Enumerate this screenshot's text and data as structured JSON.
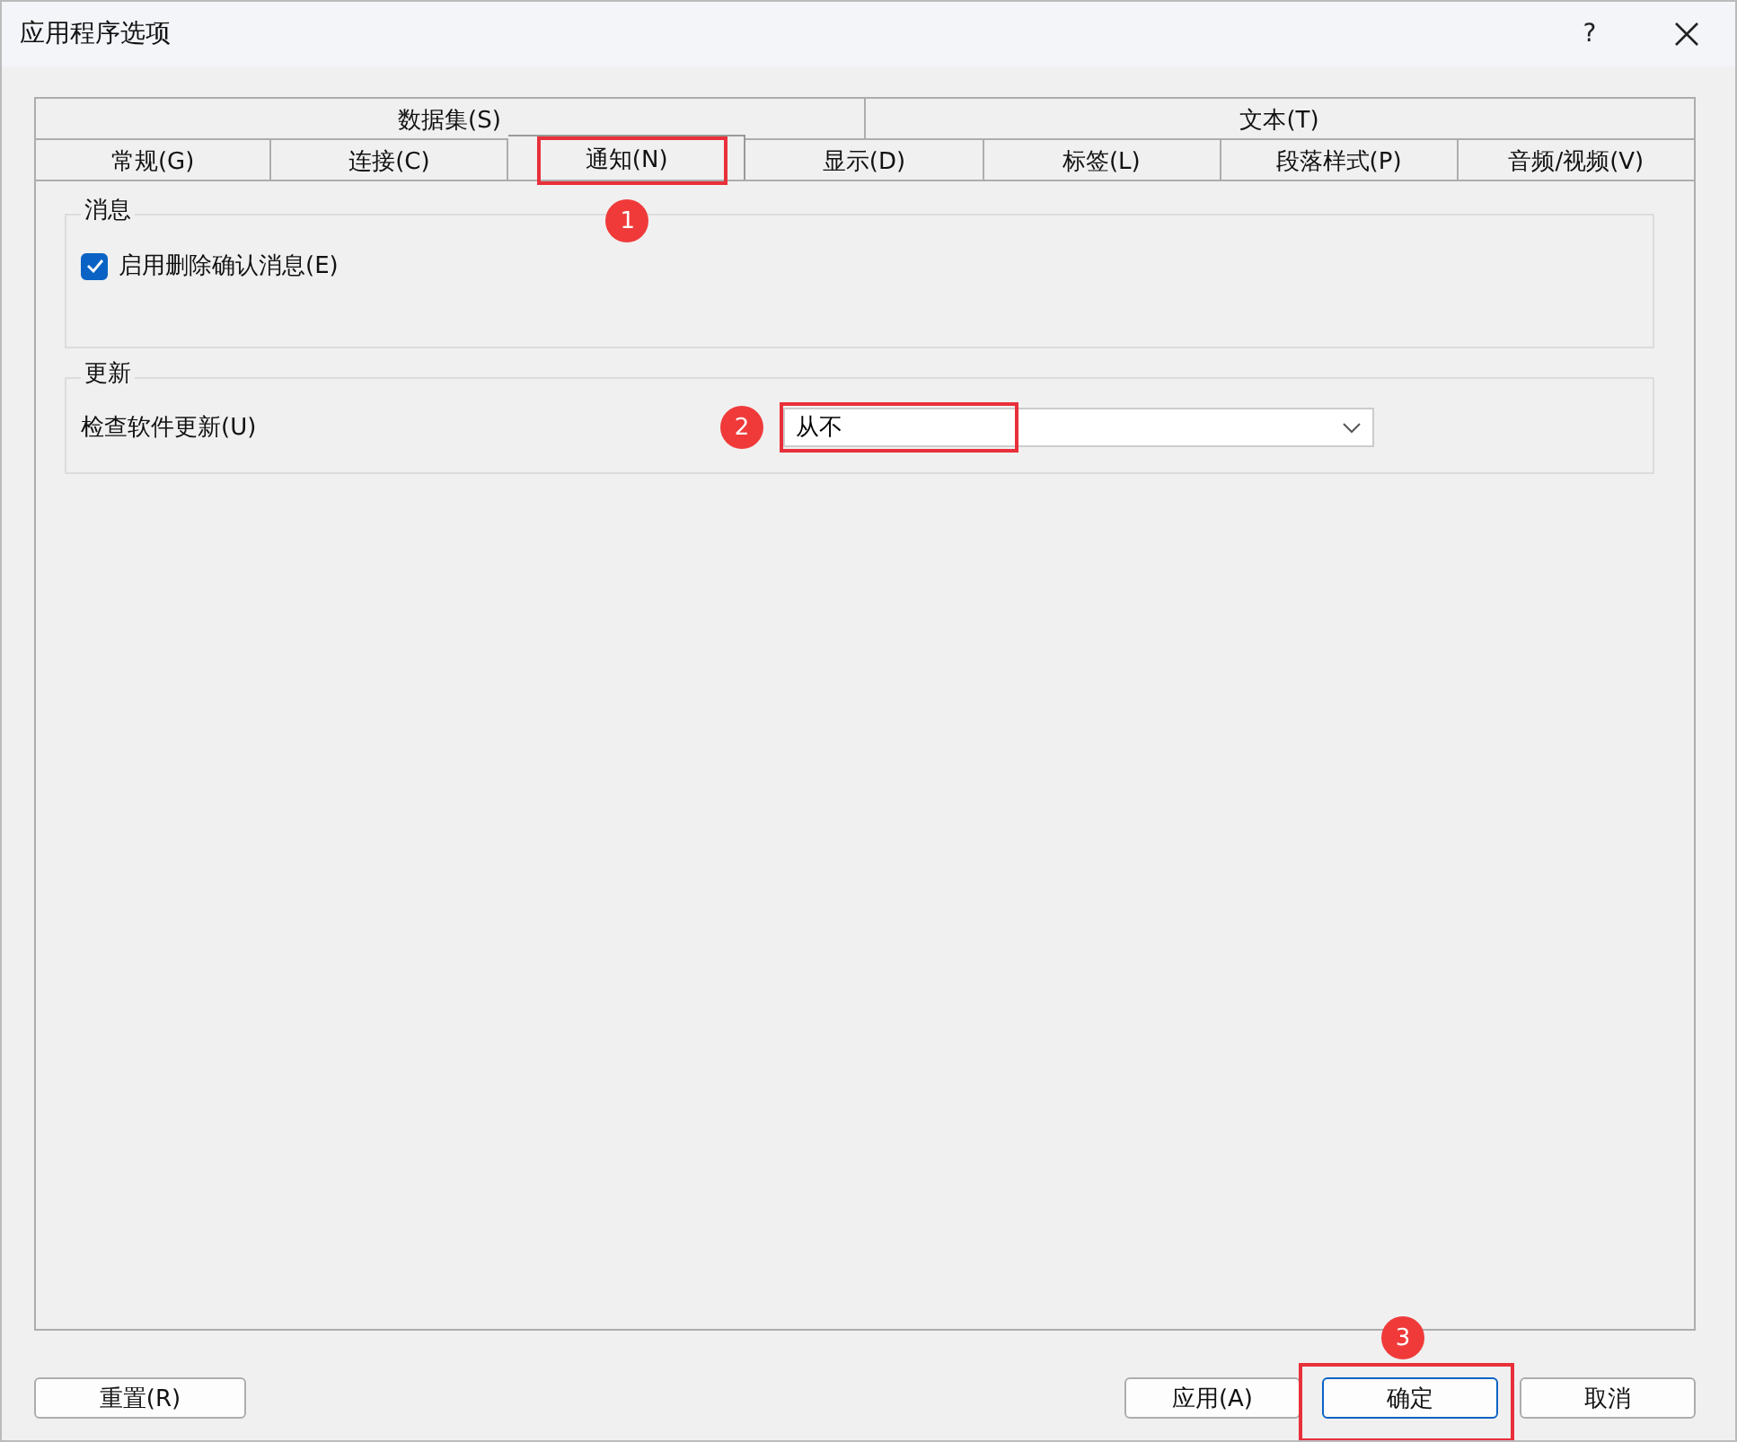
{
  "window": {
    "title": "应用程序选项",
    "help": "?"
  },
  "tab_rows": [
    {
      "tabs": [
        {
          "label": "数据集(S)",
          "selected": false
        },
        {
          "label": "文本(T)",
          "selected": false
        }
      ]
    },
    {
      "tabs": [
        {
          "label": "常规(G)",
          "selected": false
        },
        {
          "label": "连接(C)",
          "selected": false
        },
        {
          "label": "通知(N)",
          "selected": true,
          "annotation": "1"
        },
        {
          "label": "显示(D)",
          "selected": false
        },
        {
          "label": "标签(L)",
          "selected": false
        },
        {
          "label": "段落样式(P)",
          "selected": false
        },
        {
          "label": "音频/视频(V)",
          "selected": false
        }
      ]
    }
  ],
  "groups": [
    {
      "title": "消息",
      "items": [
        {
          "kind": "checkbox",
          "label": "启用删除确认消息(E)",
          "checked": true
        }
      ]
    },
    {
      "title": "更新",
      "items": [
        {
          "kind": "dropdown",
          "label": "检查软件更新(U)",
          "value": "从不",
          "annotation": "2"
        }
      ]
    }
  ],
  "buttons": [
    {
      "label": "重置(R)",
      "default": false
    },
    {
      "label": "应用(A)",
      "default": false
    },
    {
      "label": "确定",
      "default": true,
      "annotation": "3"
    },
    {
      "label": "取消",
      "default": false
    }
  ]
}
